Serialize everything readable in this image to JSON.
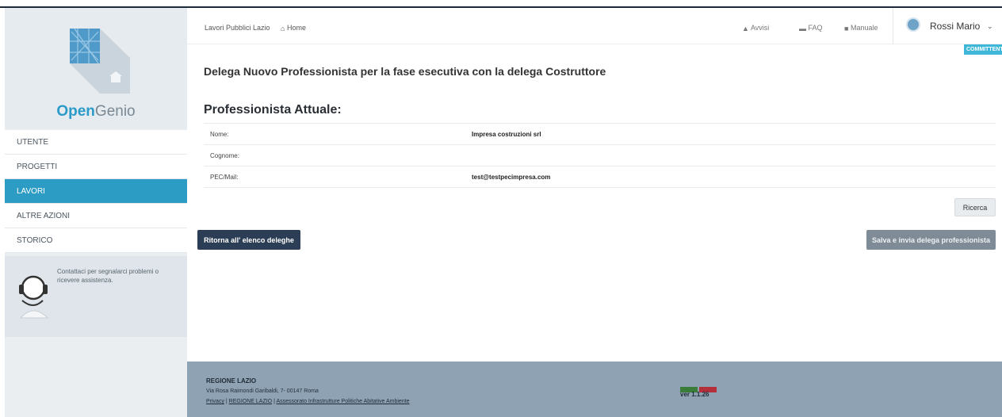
{
  "brand": {
    "bold": "Open",
    "light": "Genio"
  },
  "menu": [
    {
      "label": "UTENTE"
    },
    {
      "label": "PROGETTI"
    },
    {
      "label": "LAVORI"
    },
    {
      "label": "ALTRE AZIONI"
    },
    {
      "label": "STORICO"
    }
  ],
  "support": {
    "text": "Contattaci per segnalarci problemi o ricevere assistenza."
  },
  "topbar": {
    "site": "Lavori Pubblici Lazio",
    "home": "Home",
    "links": {
      "avvisi": "Avvisi",
      "faq": "FAQ",
      "manuale": "Manuale"
    },
    "user": "Rossi Mario"
  },
  "role_badge": "COMMITTENTE",
  "heading": {
    "pre": "Delega ",
    "bold": "Nuovo",
    "post": " Professionista per la fase esecutiva con la delega Costruttore"
  },
  "section_title": "Professionista Attuale:",
  "details": [
    {
      "label": "Nome:",
      "value": "Impresa costruzioni srl"
    },
    {
      "label": "Cognome:",
      "value": ""
    },
    {
      "label": "PEC/Mail:",
      "value": "test@testpecimpresa.com"
    }
  ],
  "buttons": {
    "search": "Ricerca",
    "back": "Ritorna all' elenco deleghe",
    "save": "Salva e invia delega professionista"
  },
  "footer": {
    "title": "REGIONE LAZIO",
    "address": "Via Rosa Raimondi Garibaldi, 7- 00147 Roma",
    "links": [
      "Privacy",
      "REGIONE LAZIO",
      "Assessorato Infrastrutture Politiche Abitative Ambiente"
    ],
    "separator": " | ",
    "version": "ver 1.1.26"
  },
  "colors": {
    "accent": "#2d9cc4",
    "primary_dark": "#2c3e55",
    "footer": "#8fa2b3"
  }
}
